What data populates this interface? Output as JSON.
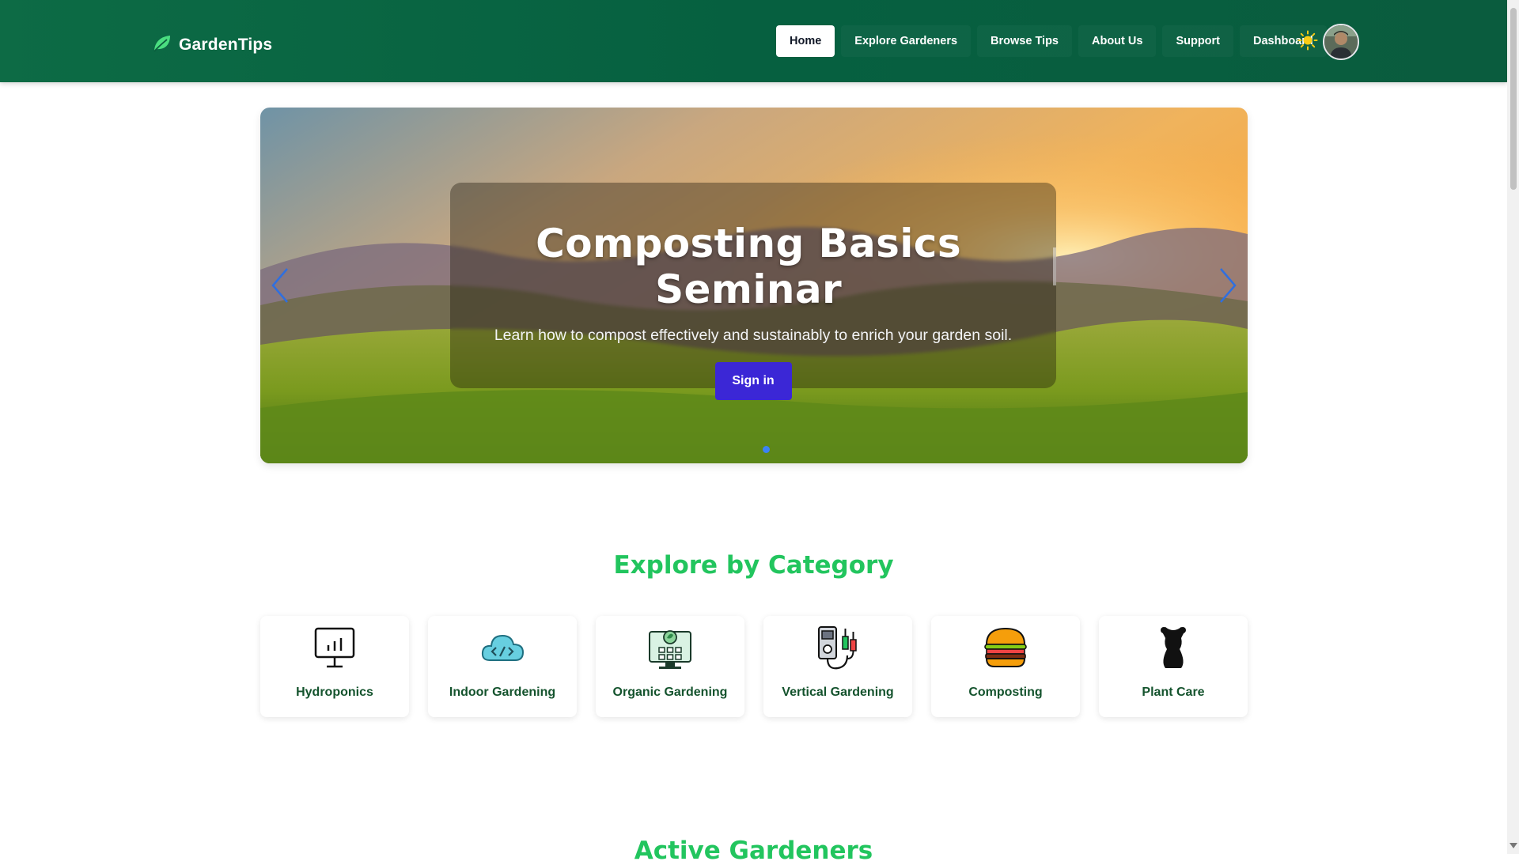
{
  "brand": {
    "name": "GardenTips",
    "icon": "leaf-icon",
    "icon_color": "#4ade80"
  },
  "nav": {
    "links": [
      {
        "label": "Home",
        "active": true
      },
      {
        "label": "Explore Gardeners"
      },
      {
        "label": "Browse Tips"
      },
      {
        "label": "About Us"
      },
      {
        "label": "Support"
      },
      {
        "label": "Dashboard"
      }
    ],
    "theme_toggle_icon": "sun-icon",
    "avatar": "user-avatar"
  },
  "hero": {
    "title": "Composting Basics Seminar",
    "subtitle": "Learn how to compost effectively and sustainably to enrich your garden soil.",
    "button": "Sign in",
    "prev_icon": "chevron-left-icon",
    "next_icon": "chevron-right-icon",
    "button_color": "#3b27d6"
  },
  "categories": {
    "title": "Explore by Category",
    "title_color": "#22c55e",
    "items": [
      {
        "label": "Hydroponics",
        "icon": "presentation-chart-icon"
      },
      {
        "label": "Indoor Gardening",
        "icon": "cloud-code-icon"
      },
      {
        "label": "Organic Gardening",
        "icon": "computer-plant-icon"
      },
      {
        "label": "Vertical Gardening",
        "icon": "device-cables-icon"
      },
      {
        "label": "Composting",
        "icon": "burger-icon"
      },
      {
        "label": "Plant Care",
        "icon": "dress-form-icon"
      }
    ]
  },
  "active_gardeners": {
    "title": "Active Gardeners"
  },
  "colors": {
    "nav_bg": "#066040",
    "accent_green": "#22c55e",
    "label_green": "#14532d"
  }
}
